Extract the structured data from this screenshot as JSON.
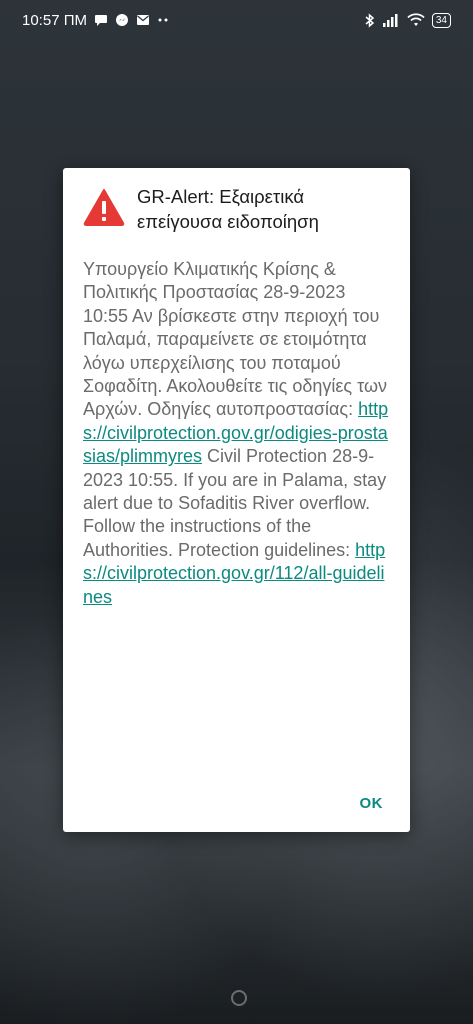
{
  "status_bar": {
    "time": "10:57 ΠΜ",
    "battery": "34"
  },
  "dialog": {
    "title": "GR-Alert: Εξαιρετικά επείγουσα ειδοποίηση",
    "body_greek": "Υπουργείο Κλιματικής Κρίσης & Πολιτικής Προστασίας 28-9-2023 10:55 Αν βρίσκεστε στην περιοχή του Παλαμά, παραμείνετε σε ετοιμότητα λόγω υπερχείλισης του ποταμού Σοφαδίτη. Ακολουθείτε τις οδηγίες των Αρχών. Οδηγίες αυτοπροστασίας:",
    "link_greek": "https://civilprotection.gov.gr/odigies-prostasias/plimmyres",
    "body_english": "Civil Protection 28-9-2023 10:55. If you are in Palama, stay alert due to Sofaditis River overflow. Follow the instructions of the Authorities. Protection guidelines:",
    "link_english": "https://civilprotection.gov.gr/112/all-guidelines",
    "ok_label": "OK"
  },
  "colors": {
    "accent": "#0b8a80",
    "warning": "#e53935"
  },
  "icons": [
    "message-icon",
    "messenger-icon",
    "mail-icon",
    "bluetooth-icon",
    "signal-icon",
    "wifi-icon",
    "battery-icon",
    "warning-icon"
  ]
}
